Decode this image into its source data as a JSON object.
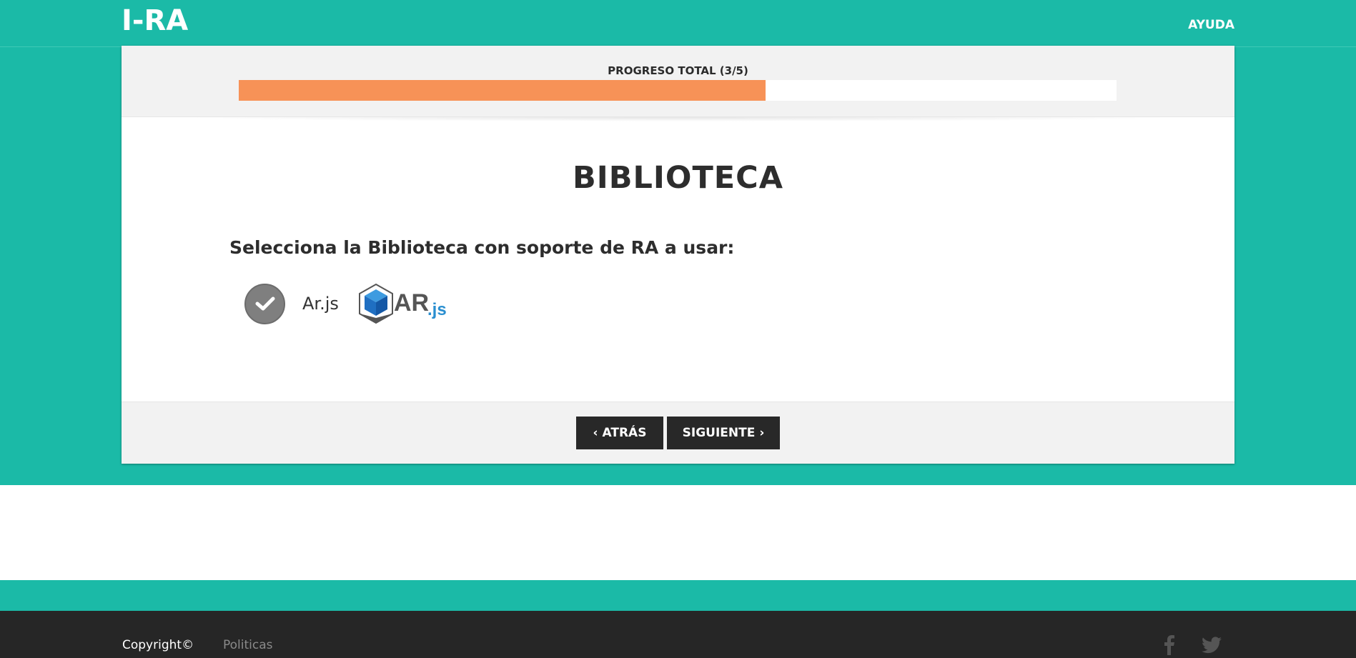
{
  "header": {
    "logo_text": "I-RA",
    "help_label": "AYUDA"
  },
  "progress": {
    "label": "PROGRESO TOTAL (3/5)",
    "value_fraction": 0.6,
    "fill_color": "#f79257"
  },
  "main": {
    "title": "BIBLIOTECA",
    "question": "Selecciona la Biblioteca con soporte de RA a usar:",
    "options": [
      {
        "label": "Ar.js",
        "selected": true,
        "icon": "check-icon",
        "logo": "arjs-logo"
      }
    ]
  },
  "nav_buttons": {
    "back_label": "ATRÁS",
    "next_label": "SIGUIENTE"
  },
  "footer": {
    "copyright": "Copyright©",
    "policies": "Politicas",
    "social": [
      "facebook-icon",
      "twitter-icon"
    ]
  },
  "colors": {
    "brand_teal": "#1bbaa7",
    "dark": "#282828",
    "accent_orange": "#f79257"
  }
}
